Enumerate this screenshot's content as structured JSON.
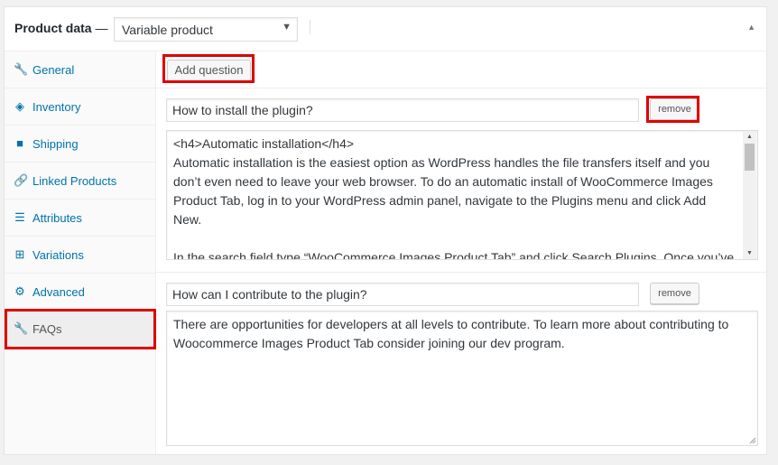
{
  "header": {
    "title": "Product data",
    "dash": "—",
    "product_type": "Variable product",
    "select_caret_icon": "caret-down",
    "collapse_icon": "triangle-up"
  },
  "sidebar": {
    "items": [
      {
        "label": "General",
        "icon": "wrench-icon",
        "glyph": "🔧"
      },
      {
        "label": "Inventory",
        "icon": "tag-icon",
        "glyph": "◈"
      },
      {
        "label": "Shipping",
        "icon": "truck-icon",
        "glyph": "■"
      },
      {
        "label": "Linked Products",
        "icon": "link-icon",
        "glyph": "🔗"
      },
      {
        "label": "Attributes",
        "icon": "list-icon",
        "glyph": "☰"
      },
      {
        "label": "Variations",
        "icon": "grid-icon",
        "glyph": "⊞"
      },
      {
        "label": "Advanced",
        "icon": "gear-icon",
        "glyph": "⚙"
      },
      {
        "label": "FAQs",
        "icon": "wrench-icon",
        "glyph": "🔧"
      }
    ],
    "active": "FAQs"
  },
  "toolbar": {
    "add_label": "Add question"
  },
  "faqs": [
    {
      "question": "How to install the plugin?",
      "remove_label": "remove",
      "answer": "<h4>Automatic installation</h4>\nAutomatic installation is the easiest option as WordPress handles the file transfers itself and you don’t even need to leave your web browser. To do an automatic install of WooCommerce Images Product Tab, log in to your WordPress admin panel, navigate to the Plugins menu and click Add New.\n\nIn the search field type “WooCommerce Images Product Tab” and click Search Plugins. Once you’ve"
    },
    {
      "question": "How can I contribute to the plugin?",
      "remove_label": "remove",
      "answer": "There are opportunities for developers at all levels to contribute. To learn more about contributing to Woocommerce Images Product Tab consider joining our dev program."
    }
  ],
  "colors": {
    "highlight": "#e00000",
    "link": "#0073aa"
  }
}
